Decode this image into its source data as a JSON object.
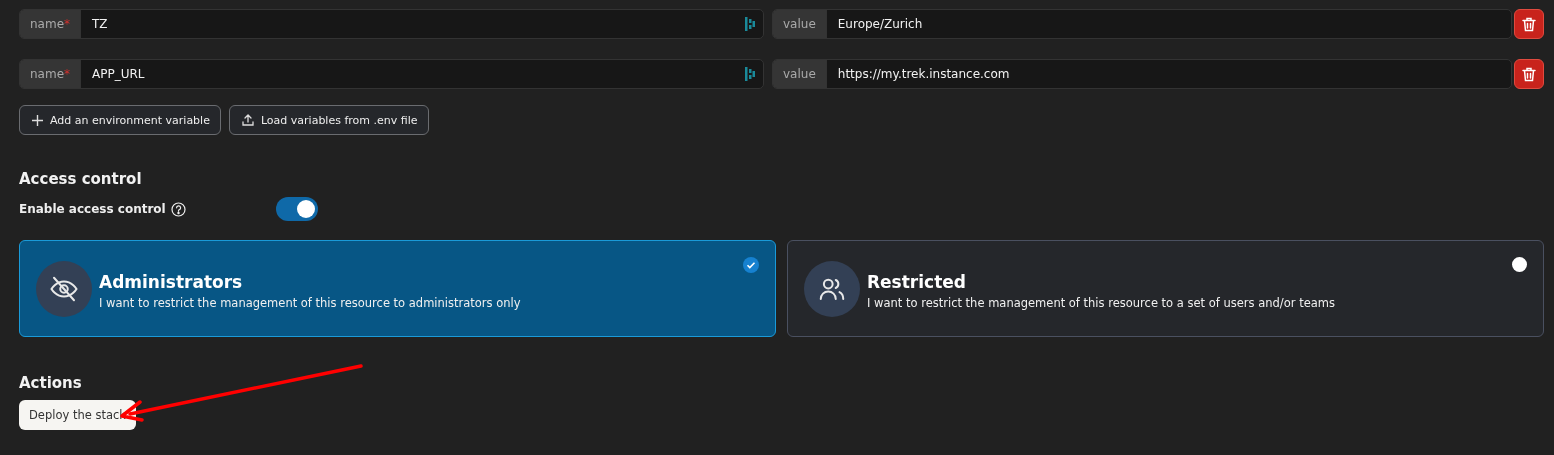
{
  "env_vars": [
    {
      "name_label": "name",
      "required_mark": "*",
      "name_value": "TZ",
      "value_label": "value",
      "value": "Europe/Zurich"
    },
    {
      "name_label": "name",
      "required_mark": "*",
      "name_value": "APP_URL",
      "value_label": "value",
      "value": "https://my.trek.instance.com"
    }
  ],
  "env_buttons": [
    {
      "kind": "add",
      "label": "Add an environment variable"
    },
    {
      "kind": "upload",
      "label": "Load variables from .env file"
    }
  ],
  "access_control": {
    "heading": "Access control",
    "toggle_label": "Enable access control",
    "on": true,
    "options": [
      {
        "kind": "admin",
        "title": "Administrators",
        "description": "I want to restrict the management of this resource to administrators only",
        "selected": true
      },
      {
        "kind": "restricted",
        "title": "Restricted",
        "description": "I want to restrict the management of this resource to a set of users and/or teams",
        "selected": false
      }
    ]
  },
  "actions": {
    "heading": "Actions",
    "buttons": [
      "Deploy the stack"
    ]
  }
}
